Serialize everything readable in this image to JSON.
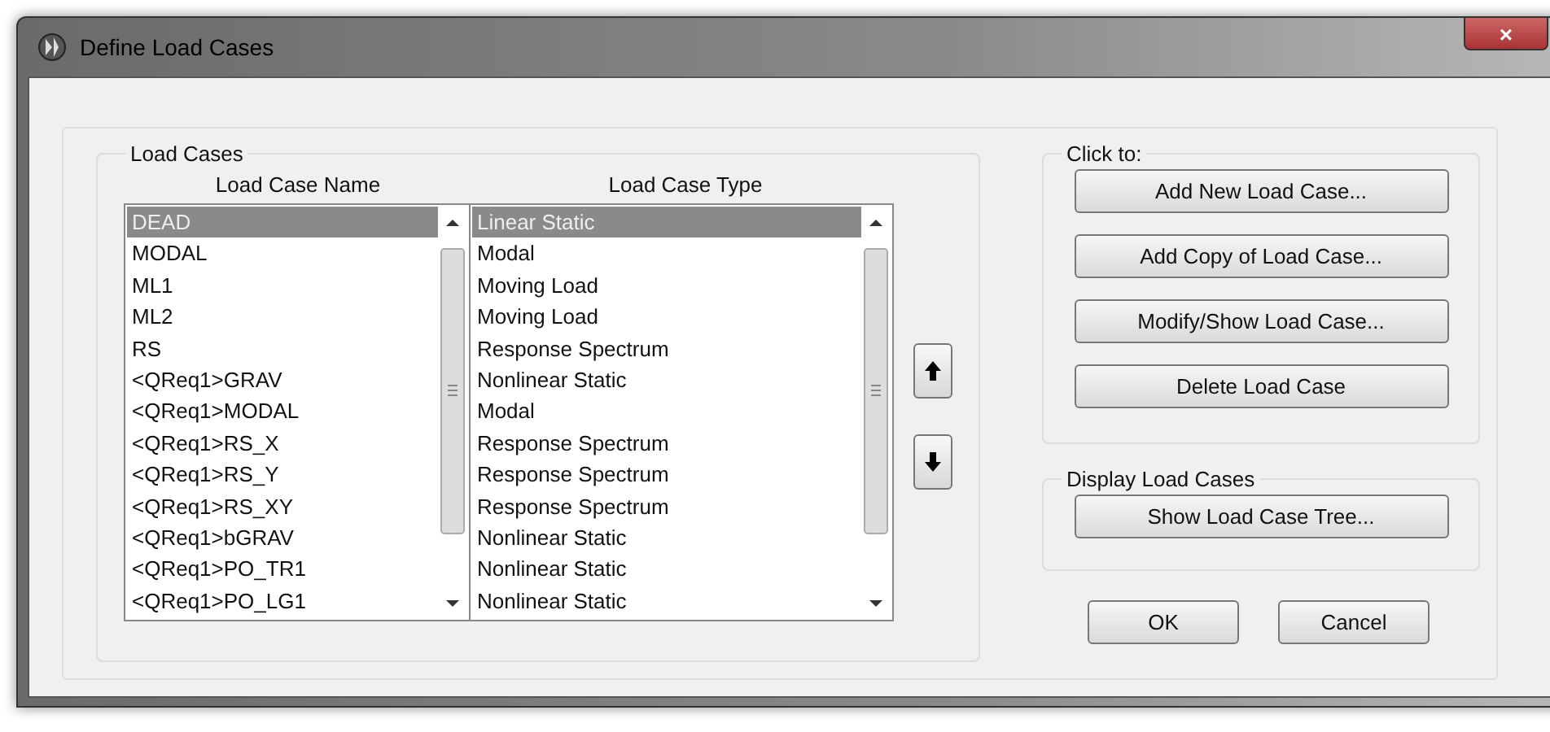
{
  "window": {
    "title": "Define Load Cases",
    "close": "×"
  },
  "load_cases_group": {
    "title": "Load Cases",
    "name_header": "Load Case Name",
    "type_header": "Load Case Type",
    "cases": [
      {
        "name": "DEAD",
        "type": "Linear Static",
        "selected": true
      },
      {
        "name": "MODAL",
        "type": "Modal",
        "selected": false
      },
      {
        "name": "ML1",
        "type": "Moving Load",
        "selected": false
      },
      {
        "name": "ML2",
        "type": "Moving Load",
        "selected": false
      },
      {
        "name": "RS",
        "type": "Response Spectrum",
        "selected": false
      },
      {
        "name": "<QReq1>GRAV",
        "type": "Nonlinear Static",
        "selected": false
      },
      {
        "name": "<QReq1>MODAL",
        "type": "Modal",
        "selected": false
      },
      {
        "name": "<QReq1>RS_X",
        "type": "Response Spectrum",
        "selected": false
      },
      {
        "name": "<QReq1>RS_Y",
        "type": "Response Spectrum",
        "selected": false
      },
      {
        "name": "<QReq1>RS_XY",
        "type": "Response Spectrum",
        "selected": false
      },
      {
        "name": "<QReq1>bGRAV",
        "type": "Nonlinear Static",
        "selected": false
      },
      {
        "name": "<QReq1>PO_TR1",
        "type": "Nonlinear Static",
        "selected": false
      },
      {
        "name": "<QReq1>PO_LG1",
        "type": "Nonlinear Static",
        "selected": false
      }
    ]
  },
  "click_to_group": {
    "title": "Click to:",
    "buttons": [
      "Add New Load Case...",
      "Add Copy of Load Case...",
      "Modify/Show Load Case...",
      "Delete Load Case"
    ]
  },
  "display_group": {
    "title": "Display Load Cases",
    "buttons": [
      "Show Load Case Tree..."
    ]
  },
  "dialog_buttons": [
    "OK",
    "Cancel"
  ]
}
